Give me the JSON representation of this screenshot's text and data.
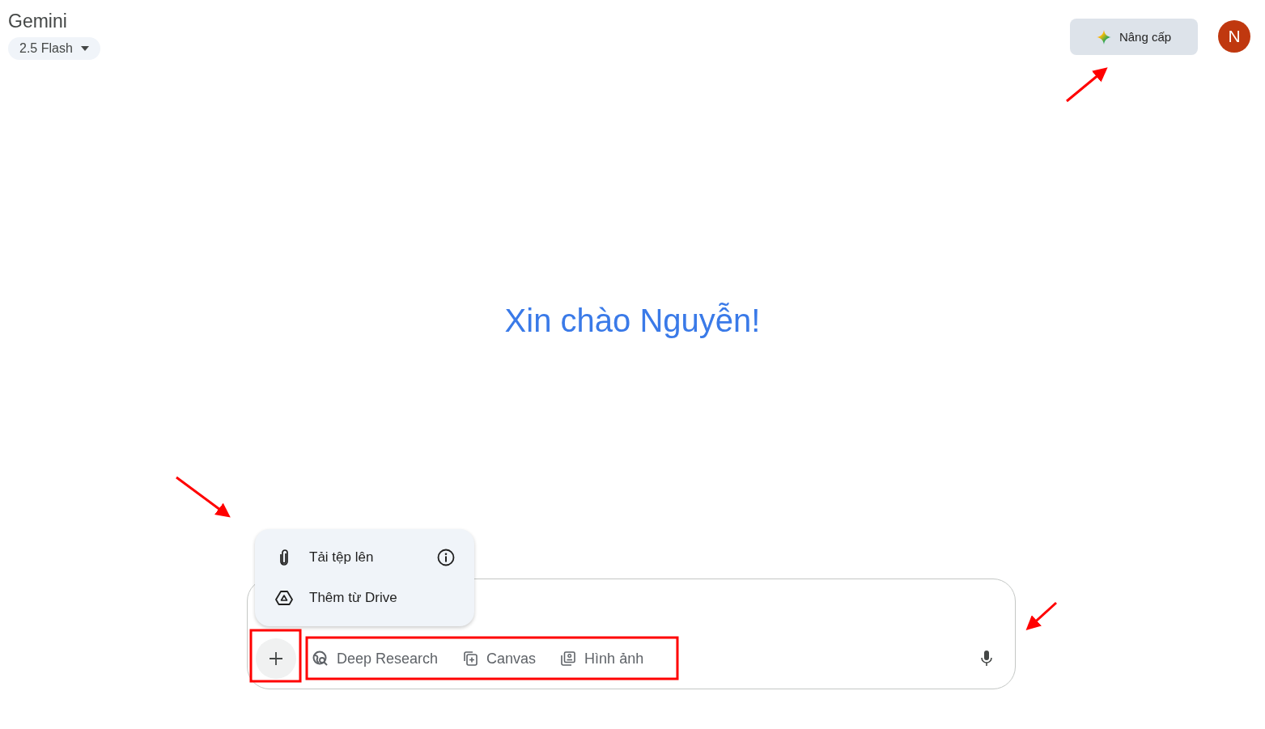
{
  "header": {
    "title": "Gemini",
    "model_selector": {
      "label": "2.5 Flash"
    }
  },
  "upgrade_button": {
    "label": "Nâng cấp"
  },
  "avatar": {
    "initial": "N"
  },
  "greeting": "Xin chào Nguyễn!",
  "attach_menu": {
    "items": [
      {
        "label": "Tải tệp lên"
      },
      {
        "label": "Thêm từ Drive"
      }
    ]
  },
  "composer": {
    "tools": [
      {
        "label": "Deep Research"
      },
      {
        "label": "Canvas"
      },
      {
        "label": "Hình ảnh"
      }
    ]
  }
}
